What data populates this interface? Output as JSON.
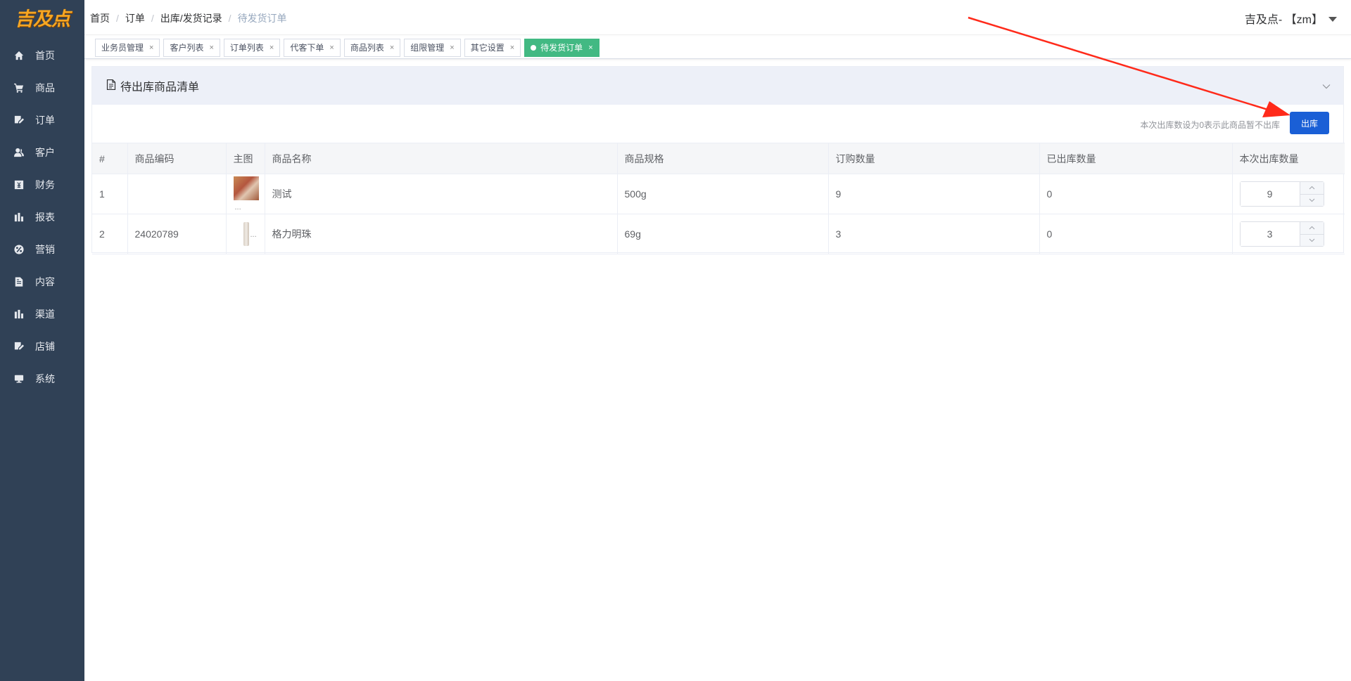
{
  "logo": {
    "text": "吉及点"
  },
  "sidebar": {
    "items": [
      {
        "label": "首页",
        "icon": "home-icon"
      },
      {
        "label": "商品",
        "icon": "cart-icon"
      },
      {
        "label": "订单",
        "icon": "edit-icon"
      },
      {
        "label": "客户",
        "icon": "user-icon"
      },
      {
        "label": "财务",
        "icon": "finance-icon"
      },
      {
        "label": "报表",
        "icon": "chart-icon"
      },
      {
        "label": "营销",
        "icon": "percent-icon"
      },
      {
        "label": "内容",
        "icon": "document-icon"
      },
      {
        "label": "渠道",
        "icon": "chart-icon"
      },
      {
        "label": "店铺",
        "icon": "edit-icon"
      },
      {
        "label": "系统",
        "icon": "monitor-icon"
      }
    ]
  },
  "breadcrumb": {
    "items": [
      "首页",
      "订单",
      "出库/发货记录",
      "待发货订单"
    ],
    "separator": "/"
  },
  "user": {
    "name": "吉及点- 【zm】"
  },
  "tags": {
    "items": [
      "业务员管理",
      "客户列表",
      "订单列表",
      "代客下单",
      "商品列表",
      "组限管理",
      "其它设置",
      "待发货订单"
    ],
    "close": "×",
    "active_index": 7,
    "active_color": "#42b983"
  },
  "card": {
    "title": "待出库商品清单",
    "tip": "本次出库数设为0表示此商品暂不出库",
    "out_button": "出库",
    "out_button_color": "#1a5fd6"
  },
  "table": {
    "headers": [
      "#",
      "商品编码",
      "主图",
      "商品名称",
      "商品规格",
      "订购数量",
      "已出库数量",
      "本次出库数量"
    ],
    "rows": [
      {
        "index": "1",
        "code": "",
        "image": "product-photo",
        "name": "测试",
        "spec": "500g",
        "ordered": "9",
        "shipped": "0",
        "qty": "9"
      },
      {
        "index": "2",
        "code": "24020789",
        "image": "bottle-photo",
        "name": "格力明珠",
        "spec": "69g",
        "ordered": "3",
        "shipped": "0",
        "qty": "3"
      }
    ],
    "image_ellipsis": "..."
  },
  "annotation": {
    "color": "#ff2a1a",
    "description": "red-arrow-pointing-to-out-button"
  }
}
